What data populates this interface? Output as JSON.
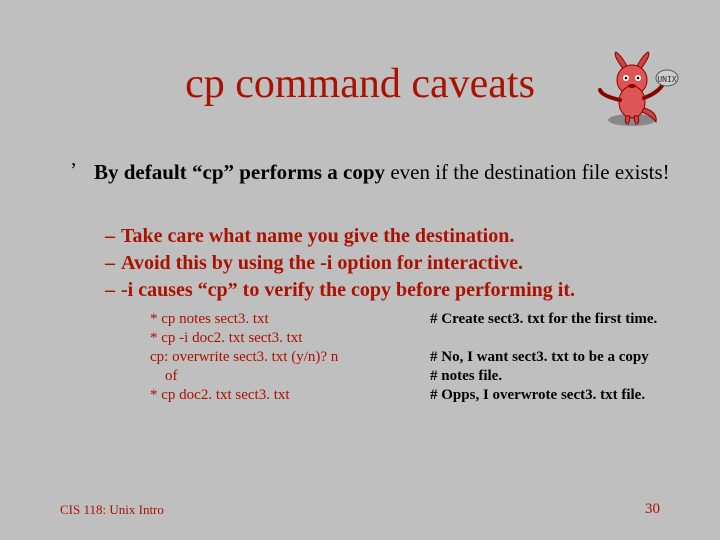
{
  "title": "cp command caveats",
  "bullet": {
    "marker": "’",
    "bold": "By default “cp” performs a copy",
    "rest": " even if the destination file exists!"
  },
  "dashes": [
    "Take care what name you give the destination.",
    "Avoid this by using the -i option for interactive.",
    "-i causes “cp” to verify the copy before performing it."
  ],
  "examples": [
    {
      "left": "*  cp notes sect3. txt",
      "right": "# Create sect3. txt for the first time."
    },
    {
      "left": "*  cp -i doc2. txt sect3. txt",
      "right": ""
    },
    {
      "left": "cp: overwrite sect3. txt (y/n)? n",
      "right": "# No, I want sect3. txt to be a copy"
    },
    {
      "left": "    of",
      "right": "# notes file."
    },
    {
      "left": "*  cp doc2. txt sect3. txt",
      "right": "# Opps,  I overwrote sect3. txt file."
    }
  ],
  "footer": {
    "left": "CIS 118: Unix Intro",
    "right": "30"
  }
}
